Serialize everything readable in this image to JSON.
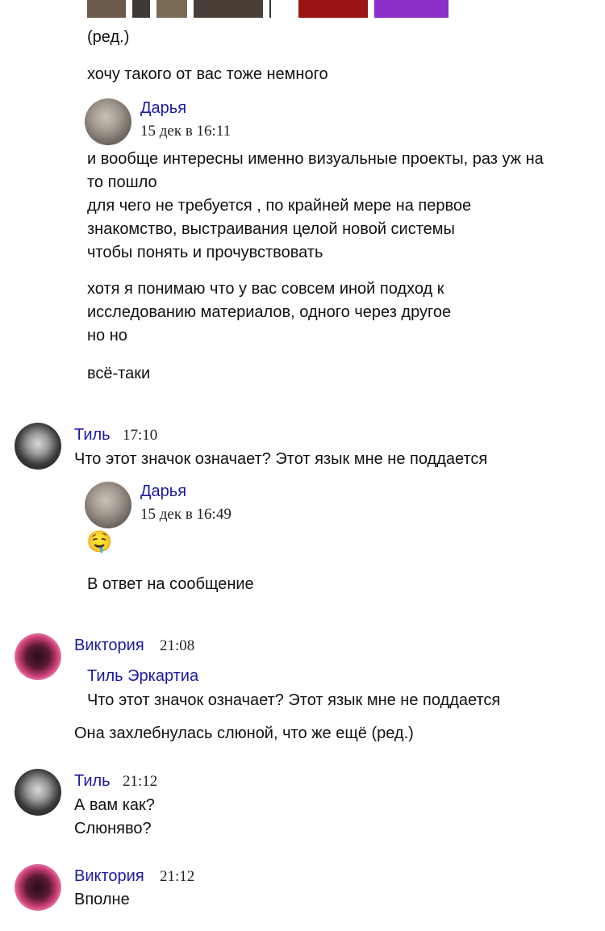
{
  "top_fragment": {
    "edited_label": "(ред.)",
    "line": "хочу такого от вас тоже немного",
    "thumb_colors": [
      "#6b5a4a",
      "#3d3a36",
      "#7a6a55",
      "#4a3f36",
      "#9a1414",
      "#8a2fc8"
    ]
  },
  "quote1": {
    "author": "Дарья",
    "timestamp": "15 дек в 16:11",
    "lines": [
      "и вообще интересны именно визуальные проекты, раз уж на",
      "то пошло",
      "для чего не требуется , по крайней мере на первое",
      "знакомство, выстраивания целой новой системы",
      "чтобы понять и прочувствовать"
    ],
    "lines2": [
      "хотя я понимаю что у вас совсем иной подход к",
      "исследованию материалов, одного через другое",
      "но но"
    ],
    "line3": "всё-таки"
  },
  "msg_til_1": {
    "author": "Тиль",
    "time": "17:10",
    "text": "Что этот значок означает? Этот язык мне не поддается"
  },
  "quote2": {
    "author": "Дарья",
    "timestamp": "15 дек в 16:49",
    "emoji": "🤤",
    "reply_label": "В ответ на сообщение"
  },
  "msg_vika_1": {
    "author": "Виктория",
    "time": "21:08",
    "reply_author": "Тиль Эркартиа",
    "reply_text": "Что этот значок означает? Этот язык мне не поддается",
    "text": "Она захлебнулась слюной, что же ещё (ред.)"
  },
  "msg_til_2": {
    "author": "Тиль",
    "time": "21:12",
    "line1": "А вам как?",
    "line2": "Слюняво?"
  },
  "msg_vika_2": {
    "author": "Виктория",
    "time": "21:12",
    "text": "Вполне"
  },
  "colors": {
    "name_link": "#1a1aa6",
    "text": "#111111",
    "background": "#ffffff"
  }
}
